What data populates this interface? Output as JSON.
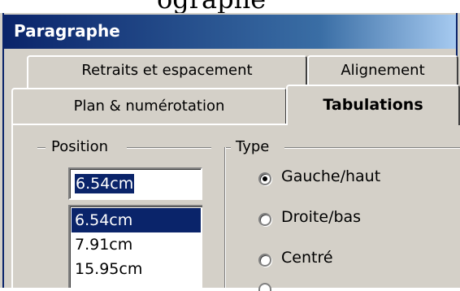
{
  "top_strip": {
    "cropped_text": "ographe"
  },
  "window": {
    "title": "Paragraphe"
  },
  "tabs": [
    {
      "label": "Retraits et espacement",
      "active": false
    },
    {
      "label": "Alignement",
      "active": false
    },
    {
      "label": "Plan & numérotation",
      "active": false
    },
    {
      "label": "Tabulations",
      "active": true
    }
  ],
  "position_group": {
    "label": "Position",
    "input_value": "6.54cm",
    "list": [
      "6.54cm",
      "7.91cm",
      "15.95cm"
    ],
    "selected_index": 0
  },
  "type_group": {
    "label": "Type",
    "options": [
      {
        "label": "Gauche/haut",
        "checked": true
      },
      {
        "label": "Droite/bas",
        "checked": false
      },
      {
        "label": "Centré",
        "checked": false
      }
    ]
  },
  "colors": {
    "title_bar": "#0a246a",
    "selection": "#0a246a",
    "face": "#d4d0c8"
  }
}
